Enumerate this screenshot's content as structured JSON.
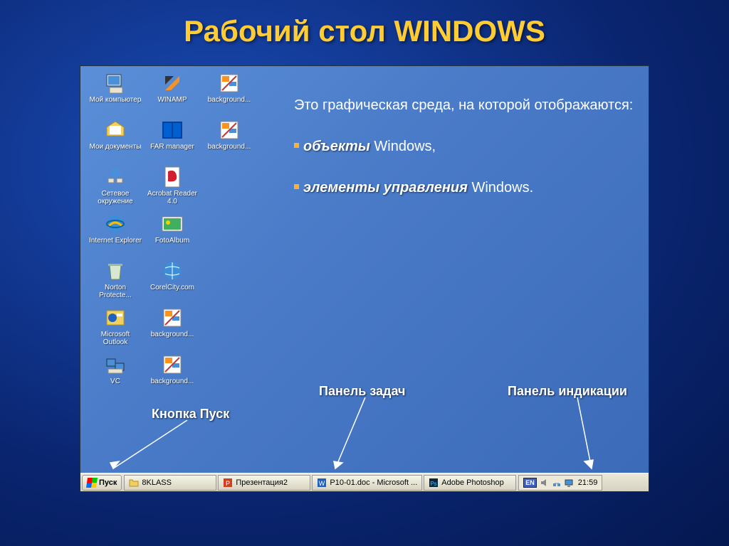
{
  "slide": {
    "title": "Рабочий стол WINDOWS"
  },
  "desktop": {
    "icons": [
      [
        {
          "name": "my-computer",
          "label": "Мой компьютер",
          "glyph": "computer"
        },
        {
          "name": "winamp",
          "label": "WINAMP",
          "glyph": "winamp"
        },
        {
          "name": "background1",
          "label": "background...",
          "glyph": "paint"
        }
      ],
      [
        {
          "name": "my-documents",
          "label": "Мои документы",
          "glyph": "docs"
        },
        {
          "name": "far-manager",
          "label": "FAR manager",
          "glyph": "far"
        },
        {
          "name": "background2",
          "label": "background...",
          "glyph": "paint"
        }
      ],
      [
        {
          "name": "network",
          "label": "Сетевое окружение",
          "glyph": "network"
        },
        {
          "name": "acrobat",
          "label": "Acrobat Reader 4.0",
          "glyph": "pdf"
        },
        null
      ],
      [
        {
          "name": "ie",
          "label": "Internet Explorer",
          "glyph": "ie"
        },
        {
          "name": "fotoalbum",
          "label": "FotoAlbum",
          "glyph": "photo"
        },
        null
      ],
      [
        {
          "name": "norton",
          "label": "Norton Protecte...",
          "glyph": "bin"
        },
        {
          "name": "corelcity",
          "label": "CorelCity.com",
          "glyph": "globe"
        },
        null
      ],
      [
        {
          "name": "outlook",
          "label": "Microsoft Outlook",
          "glyph": "outlook"
        },
        {
          "name": "background3",
          "label": "background...",
          "glyph": "paint"
        },
        null
      ],
      [
        {
          "name": "vc",
          "label": "VC",
          "glyph": "vc"
        },
        {
          "name": "background4",
          "label": "background...",
          "glyph": "paint"
        },
        null
      ]
    ]
  },
  "body": {
    "intro": "Это графическая среда, на которой отображаются:",
    "bullets": [
      {
        "strong": "объекты",
        "rest": " Windows,"
      },
      {
        "strong": "элементы управления",
        "rest": " Windows."
      }
    ]
  },
  "callouts": {
    "start": "Кнопка Пуск",
    "taskbar": "Панель задач",
    "tray": "Панель индикации"
  },
  "taskbar": {
    "start_label": "Пуск",
    "buttons": [
      {
        "name": "task-8klass",
        "label": "8KLASS",
        "glyph": "folder"
      },
      {
        "name": "task-present",
        "label": "Презентация2",
        "glyph": "ppt"
      },
      {
        "name": "task-word",
        "label": "P10-01.doc - Microsoft ...",
        "glyph": "word"
      },
      {
        "name": "task-photoshop",
        "label": "Adobe Photoshop",
        "glyph": "ps"
      }
    ],
    "tray": {
      "lang": "EN",
      "icons": [
        "vol",
        "net",
        "disp"
      ],
      "clock": "21:59"
    }
  }
}
